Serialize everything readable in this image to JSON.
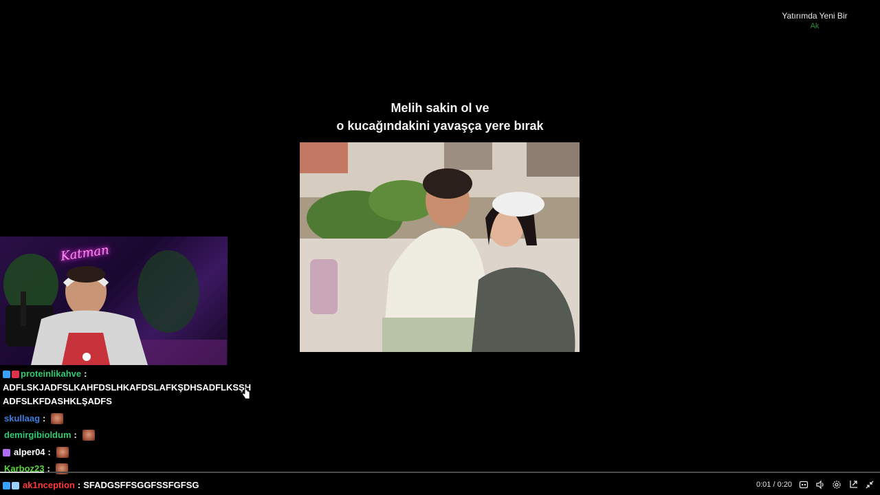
{
  "corner_ad": {
    "line1": "Yatırımda Yeni Bir",
    "line2": "Ak"
  },
  "caption": {
    "line1": "Melih sakin ol ve",
    "line2": "o kucağındakini yavaşça yere bırak"
  },
  "webcam": {
    "neon_sign": "Katman"
  },
  "chat": {
    "messages": [
      {
        "user": "proteinlikahve",
        "user_color": "#2ecc71",
        "text_line1": "ADFLSKJADFSLKAHFDSLHKAFDSLAFKŞDHSADFLKSŞH",
        "text_line2": "ADFSLKFDASHKLŞADFS",
        "badges": [
          "#3aa0ff",
          "#e0304a"
        ]
      },
      {
        "user": "skullaag",
        "user_color": "#3d7fe0",
        "emote": "emote"
      },
      {
        "user": "demirgibioldum",
        "user_color": "#2ecc71",
        "emote": "emote"
      },
      {
        "user": "alper04",
        "user_color": "#ffffff",
        "emote": "emote",
        "badges": [
          "#b06cf0"
        ]
      },
      {
        "user": "Karboz23",
        "user_color": "#59d63c",
        "emote": "emote"
      },
      {
        "user": "ak1nception",
        "user_color": "#ff3a3a",
        "text": "SFADGSFFSGGFSSFGFSG",
        "badges": [
          "#3aa0ff",
          "#9ad0ff"
        ]
      }
    ]
  },
  "player": {
    "time": "0:01 / 0:20",
    "progress": 0.05,
    "icons": [
      "captions-icon",
      "volume-icon",
      "settings-icon",
      "popout-icon",
      "minimize-icon"
    ]
  }
}
